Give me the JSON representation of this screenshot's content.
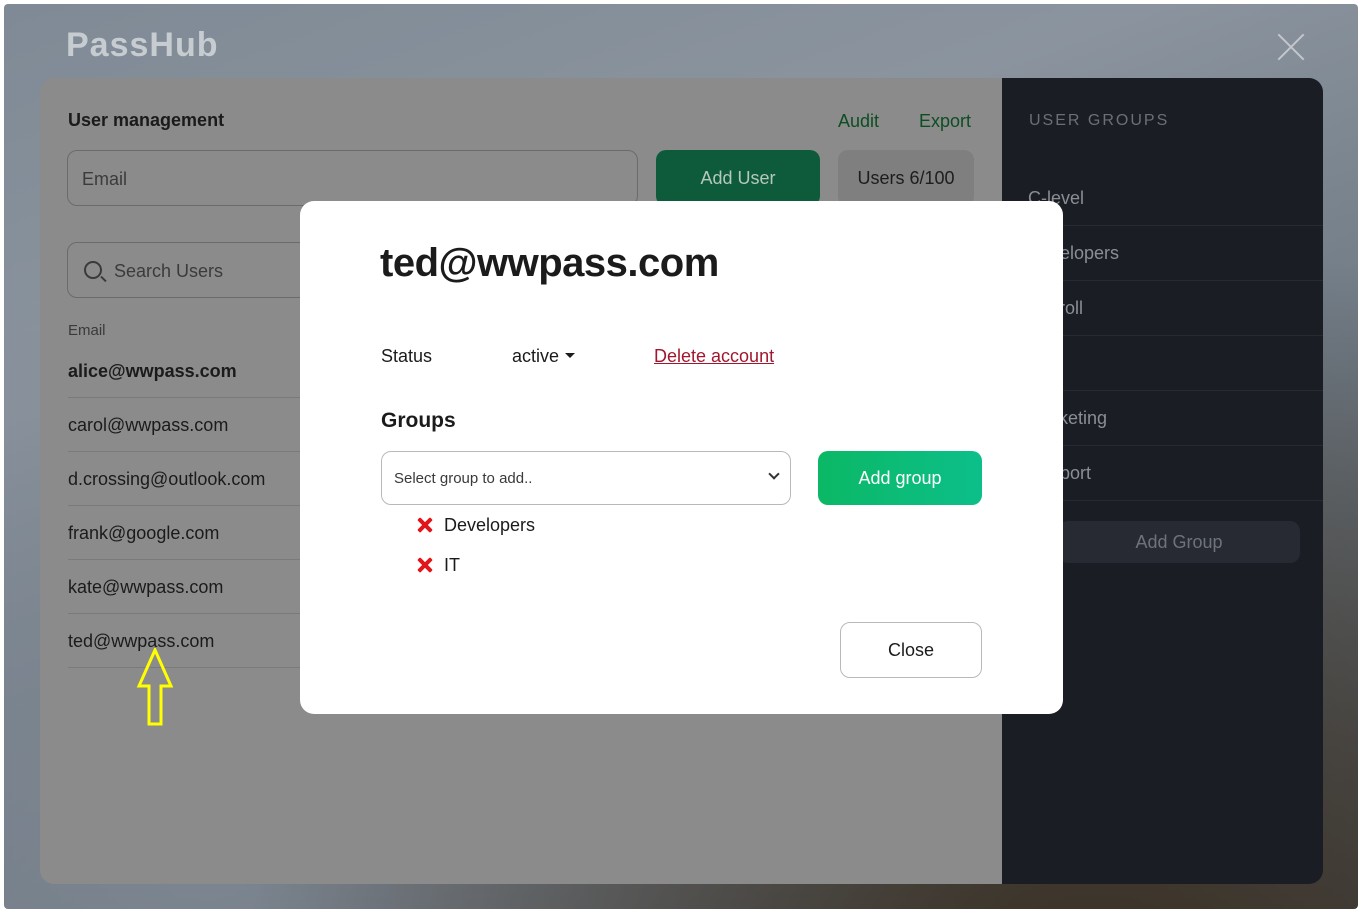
{
  "app": {
    "logo": "PassHub"
  },
  "main": {
    "title": "User management",
    "links": {
      "audit": "Audit",
      "export": "Export"
    },
    "email_placeholder": "Email",
    "add_user_label": "Add User",
    "users_count": "Users 6/100",
    "search_placeholder": "Search Users",
    "column_header": "Email",
    "users": [
      "alice@wwpass.com",
      "carol@wwpass.com",
      "d.crossing@outlook.com",
      "frank@google.com",
      "kate@wwpass.com",
      "ted@wwpass.com"
    ]
  },
  "sidebar": {
    "title": "USER GROUPS",
    "groups": [
      "C-level",
      "Developers",
      "Payroll",
      "",
      "Marketing",
      "Support"
    ],
    "add_group_label": "Add Group"
  },
  "modal": {
    "title": "ted@wwpass.com",
    "status_label": "Status",
    "status_value": "active",
    "delete_label": "Delete account",
    "groups_title": "Groups",
    "select_placeholder": "Select group to add..",
    "add_group_label": "Add group",
    "assigned_groups": [
      "Developers",
      "IT"
    ],
    "close_label": "Close"
  },
  "colors": {
    "accent_green": "#0bb865",
    "delete_red": "#a0172f",
    "remove_icon_red": "#e0161b",
    "arrow_yellow": "#ffff00"
  }
}
